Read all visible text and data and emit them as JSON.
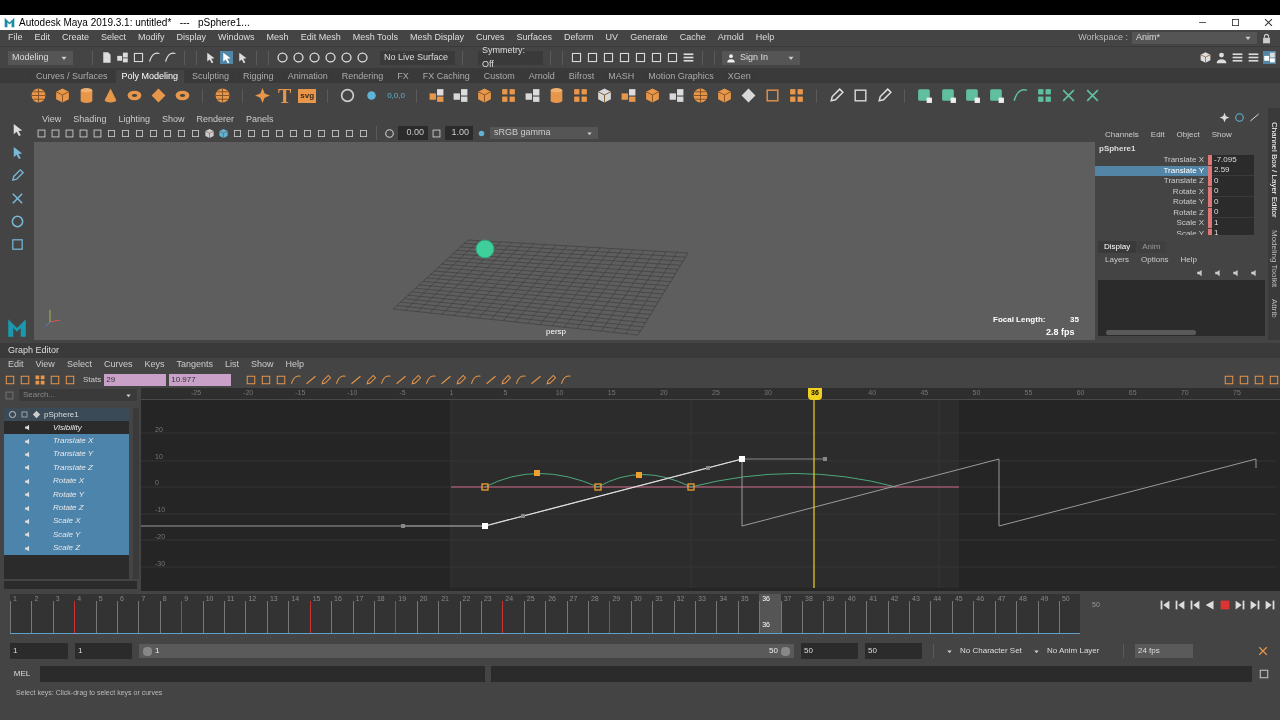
{
  "window": {
    "title": "Autodesk Maya 2019.3.1: untitled*   ---   pSphere1..."
  },
  "menu": [
    "File",
    "Edit",
    "Create",
    "Select",
    "Modify",
    "Display",
    "Windows",
    "Mesh",
    "Edit Mesh",
    "Mesh Tools",
    "Mesh Display",
    "Curves",
    "Surfaces",
    "Deform",
    "UV",
    "Generate",
    "Cache",
    "Arnold",
    "Help"
  ],
  "workspace": {
    "label": "Workspace :",
    "value": "Anim*"
  },
  "status_line": {
    "mode": "Modeling",
    "live_surface": "No Live Surface",
    "symmetry": "Symmetry: Off",
    "sign_in": "Sign In"
  },
  "shelf_tabs": [
    {
      "label": "Curves / Surfaces",
      "selected": false
    },
    {
      "label": "Poly Modeling",
      "selected": true
    },
    {
      "label": "Sculpting",
      "selected": false
    },
    {
      "label": "Rigging",
      "selected": false
    },
    {
      "label": "Animation",
      "selected": false
    },
    {
      "label": "Rendering",
      "selected": false
    },
    {
      "label": "FX",
      "selected": false
    },
    {
      "label": "FX Caching",
      "selected": false
    },
    {
      "label": "Custom",
      "selected": false
    },
    {
      "label": "Arnold",
      "selected": false
    },
    {
      "label": "Bifrost",
      "selected": false
    },
    {
      "label": "MASH",
      "selected": false
    },
    {
      "label": "Motion Graphics",
      "selected": false
    },
    {
      "label": "XGen",
      "selected": false
    }
  ],
  "shelf_labels": {
    "text_tool": "T",
    "svg_tool": "svg",
    "locator_values": "0,0,0"
  },
  "viewport": {
    "menu": [
      "View",
      "Shading",
      "Lighting",
      "Show",
      "Renderer",
      "Panels"
    ],
    "exposure": "0.00",
    "gamma": "1.00",
    "color_space": "sRGB gamma",
    "camera": "persp",
    "focal_label": "Focal Length:",
    "focal_value": "35",
    "fps": "2.8 fps"
  },
  "channel_box": {
    "menu": [
      "Channels",
      "Edit",
      "Object",
      "Show"
    ],
    "object": "pSphere1",
    "channels": [
      {
        "name": "Translate X",
        "value": "-7.095",
        "selected": false
      },
      {
        "name": "Translate Y",
        "value": "2.59",
        "selected": true
      },
      {
        "name": "Translate Z",
        "value": "0",
        "selected": false
      },
      {
        "name": "Rotate X",
        "value": "0",
        "selected": false
      },
      {
        "name": "Rotate Y",
        "value": "0",
        "selected": false
      },
      {
        "name": "Rotate Z",
        "value": "0",
        "selected": false
      },
      {
        "name": "Scale X",
        "value": "1",
        "selected": false
      },
      {
        "name": "Scale Y",
        "value": "1",
        "selected": false
      }
    ],
    "layer_tabs": [
      {
        "label": "Display",
        "selected": true
      },
      {
        "label": "Anim",
        "selected": false
      }
    ],
    "layer_menu": [
      "Layers",
      "Options",
      "Help"
    ],
    "side_tabs": [
      "Channel Box / Layer Editor",
      "Modeling Toolkit",
      "Attrib"
    ]
  },
  "graph_editor": {
    "title": "Graph Editor",
    "menu": [
      "Edit",
      "View",
      "Select",
      "Curves",
      "Keys",
      "Tangents",
      "List",
      "Show",
      "Help"
    ],
    "stats_label": "Stats",
    "stats": [
      "29",
      "10.977"
    ],
    "search_placeholder": "Search...",
    "object": "pSphere1",
    "attributes": [
      {
        "name": "Visibility",
        "selected": false
      },
      {
        "name": "Translate X",
        "selected": true
      },
      {
        "name": "Translate Y",
        "selected": true
      },
      {
        "name": "Translate Z",
        "selected": true
      },
      {
        "name": "Rotate X",
        "selected": true
      },
      {
        "name": "Rotate Y",
        "selected": true
      },
      {
        "name": "Rotate Z",
        "selected": true
      },
      {
        "name": "Scale X",
        "selected": true
      },
      {
        "name": "Scale Y",
        "selected": true
      },
      {
        "name": "Scale Z",
        "selected": true
      }
    ],
    "ruler": [
      "-25",
      "-20",
      "-15",
      "-10",
      "-5",
      "1",
      "5",
      "10",
      "15",
      "20",
      "25",
      "30",
      "40",
      "45",
      "50",
      "55",
      "60",
      "65",
      "70",
      "75"
    ],
    "current_frame": "36",
    "y_labels": [
      "20",
      "10",
      "0",
      "-10",
      "-20",
      "-30"
    ]
  },
  "time_slider": {
    "frames": [
      {
        "label": "1",
        "key": false,
        "selected": false
      },
      {
        "label": "2",
        "key": false,
        "selected": false
      },
      {
        "label": "3",
        "key": false,
        "selected": false
      },
      {
        "label": "4",
        "key": true,
        "selected": false
      },
      {
        "label": "5",
        "key": false,
        "selected": false
      },
      {
        "label": "6",
        "key": false,
        "selected": false
      },
      {
        "label": "7",
        "key": false,
        "selected": false
      },
      {
        "label": "8",
        "key": false,
        "selected": false
      },
      {
        "label": "9",
        "key": true,
        "selected": false
      },
      {
        "label": "10",
        "key": false,
        "selected": false
      },
      {
        "label": "11",
        "key": false,
        "selected": false
      },
      {
        "label": "12",
        "key": false,
        "selected": false
      },
      {
        "label": "13",
        "key": false,
        "selected": false
      },
      {
        "label": "14",
        "key": false,
        "selected": false
      },
      {
        "label": "15",
        "key": true,
        "selected": false
      },
      {
        "label": "16",
        "key": false,
        "selected": false
      },
      {
        "label": "17",
        "key": false,
        "selected": false
      },
      {
        "label": "18",
        "key": false,
        "selected": false
      },
      {
        "label": "19",
        "key": true,
        "selected": false
      },
      {
        "label": "20",
        "key": false,
        "selected": false
      },
      {
        "label": "21",
        "key": false,
        "selected": false
      },
      {
        "label": "22",
        "key": false,
        "selected": false
      },
      {
        "label": "23",
        "key": false,
        "selected": false
      },
      {
        "label": "24",
        "key": true,
        "selected": false
      },
      {
        "label": "25",
        "key": false,
        "selected": false
      },
      {
        "label": "26",
        "key": false,
        "selected": false
      },
      {
        "label": "27",
        "key": false,
        "selected": false
      },
      {
        "label": "28",
        "key": false,
        "selected": false
      },
      {
        "label": "29",
        "key": true,
        "selected": false
      },
      {
        "label": "30",
        "key": false,
        "selected": false
      },
      {
        "label": "31",
        "key": false,
        "selected": false
      },
      {
        "label": "32",
        "key": false,
        "selected": false
      },
      {
        "label": "33",
        "key": false,
        "selected": false
      },
      {
        "label": "34",
        "key": false,
        "selected": false
      },
      {
        "label": "35",
        "key": false,
        "selected": false
      },
      {
        "label": "36",
        "key": false,
        "selected": true
      },
      {
        "label": "37",
        "key": false,
        "selected": false
      },
      {
        "label": "38",
        "key": false,
        "selected": false
      },
      {
        "label": "39",
        "key": false,
        "selected": false
      },
      {
        "label": "40",
        "key": false,
        "selected": false
      },
      {
        "label": "41",
        "key": false,
        "selected": false
      },
      {
        "label": "42",
        "key": false,
        "selected": false
      },
      {
        "label": "43",
        "key": false,
        "selected": false
      },
      {
        "label": "44",
        "key": false,
        "selected": false
      },
      {
        "label": "45",
        "key": false,
        "selected": false
      },
      {
        "label": "46",
        "key": false,
        "selected": false
      },
      {
        "label": "47",
        "key": false,
        "selected": false
      },
      {
        "label": "48",
        "key": false,
        "selected": false
      },
      {
        "label": "49",
        "key": false,
        "selected": false
      },
      {
        "label": "50",
        "key": false,
        "selected": false
      }
    ],
    "current_label": "36",
    "end_label": "50"
  },
  "range": {
    "level": 1,
    "start": "1",
    "playback_start": "1",
    "bar_start": "1",
    "bar_end": "50",
    "playback_end": "50",
    "end": "50",
    "character_set": "No Character Set",
    "anim_layer": "No Anim Layer",
    "fps": "24 fps"
  },
  "command_line": {
    "label": "MEL"
  },
  "help_line": "Select keys: Click-drag to select keys or curves"
}
